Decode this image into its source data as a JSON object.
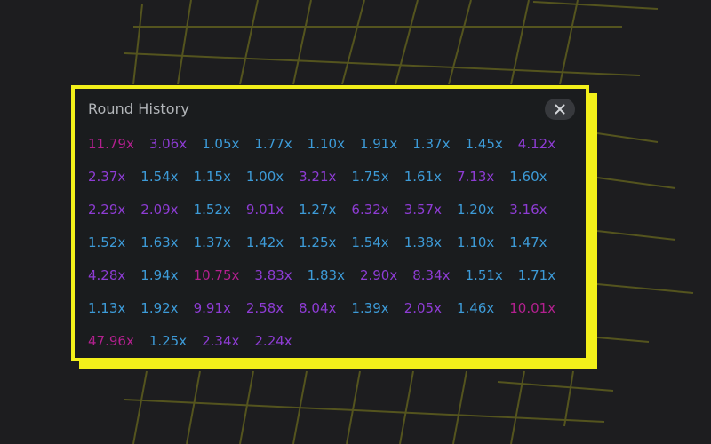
{
  "title": "Round History",
  "colors": {
    "accent": "#f3f01a",
    "low": "#3d9bd8",
    "mid": "#8e3cd4",
    "high": "#b3208f"
  },
  "icons": {
    "close": "close-icon"
  },
  "multipliers": [
    [
      "11.79x",
      "3.06x",
      "1.05x",
      "1.77x",
      "1.10x",
      "1.91x",
      "1.37x",
      "1.45x",
      "4.12x"
    ],
    [
      "2.37x",
      "1.54x",
      "1.15x",
      "1.00x",
      "3.21x",
      "1.75x",
      "1.61x",
      "7.13x",
      "1.60x"
    ],
    [
      "2.29x",
      "2.09x",
      "1.52x",
      "9.01x",
      "1.27x",
      "6.32x",
      "3.57x",
      "1.20x",
      "3.16x"
    ],
    [
      "1.52x",
      "1.63x",
      "1.37x",
      "1.42x",
      "1.25x",
      "1.54x",
      "1.38x",
      "1.10x",
      "1.47x"
    ],
    [
      "4.28x",
      "1.94x",
      "10.75x",
      "3.83x",
      "1.83x",
      "2.90x",
      "8.34x",
      "1.51x",
      "1.71x"
    ],
    [
      "1.13x",
      "1.92x",
      "9.91x",
      "2.58x",
      "8.04x",
      "1.39x",
      "2.05x",
      "1.46x",
      "10.01x"
    ],
    [
      "47.96x",
      "1.25x",
      "2.34x",
      "2.24x"
    ]
  ]
}
